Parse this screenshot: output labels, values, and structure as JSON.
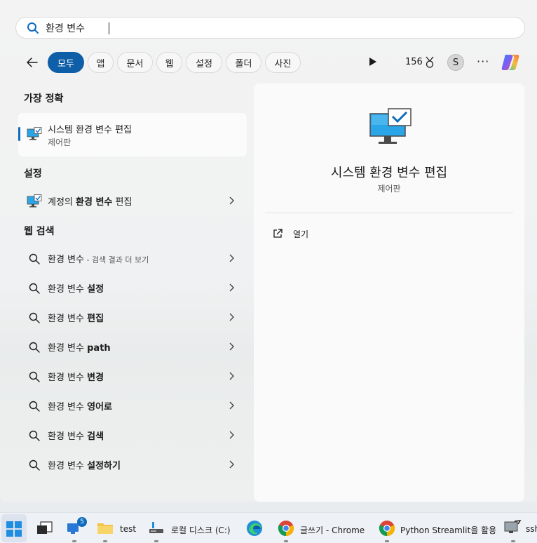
{
  "search": {
    "value": "환경 변수"
  },
  "tabs": [
    {
      "label": "모두",
      "active": true
    },
    {
      "label": "앱"
    },
    {
      "label": "문서"
    },
    {
      "label": "웹"
    },
    {
      "label": "설정"
    },
    {
      "label": "폴더"
    },
    {
      "label": "사진"
    }
  ],
  "toolbar": {
    "points": "156",
    "avatar_initial": "S",
    "more": "···"
  },
  "best_match": {
    "heading": "가장 정확",
    "title": "시스템 환경 변수 편집",
    "subtitle": "제어판"
  },
  "settings": {
    "heading": "설정",
    "item_prefix": "계정의 ",
    "item_bold": "환경 변수",
    "item_suffix": " 편집"
  },
  "web": {
    "heading": "웹 검색",
    "first": {
      "query": "환경 변수",
      "hint": " - 검색 결과 더 보기"
    },
    "items": [
      {
        "prefix": "환경 변수 ",
        "bold": "설정"
      },
      {
        "prefix": "환경 변수 ",
        "bold": "편집"
      },
      {
        "prefix": "환경 변수 ",
        "bold": "path"
      },
      {
        "prefix": "환경 변수 ",
        "bold": "변경"
      },
      {
        "prefix": "환경 변수 ",
        "bold": "영어로"
      },
      {
        "prefix": "환경 변수 ",
        "bold": "검색"
      },
      {
        "prefix": "환경 변수 ",
        "bold": "설정하기"
      }
    ]
  },
  "detail": {
    "title": "시스템 환경 변수 편집",
    "subtitle": "제어판",
    "open_label": "열기"
  },
  "taskbar": {
    "mail_badge": "5",
    "folder_label": "test",
    "disk_label": "로컬 디스크 (C:)",
    "chrome1_label": "글쓰기 - Chrome",
    "chrome2_label": "Python Streamlit을 활용",
    "ssh_label": "ssh"
  },
  "colors": {
    "accent": "#0f5ea8",
    "panel": "#f3f3f3"
  }
}
